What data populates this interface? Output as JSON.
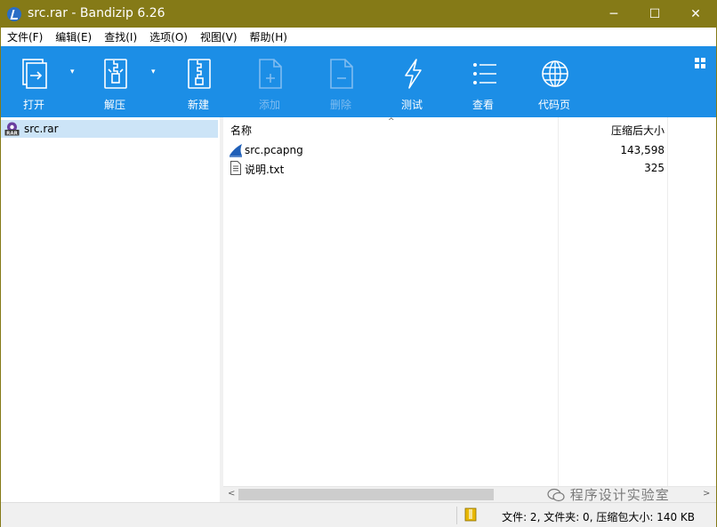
{
  "window": {
    "title": "src.rar - Bandizip 6.26",
    "title_color": "#857a17"
  },
  "titlebar_buttons": {
    "minimize": "─",
    "maximize": "☐",
    "close": "✕"
  },
  "menu": [
    "文件(F)",
    "编辑(E)",
    "查找(I)",
    "选项(O)",
    "视图(V)",
    "帮助(H)"
  ],
  "toolbar": {
    "background": "#1c8ee6",
    "buttons": [
      {
        "label": "打开",
        "icon": "open-file-icon",
        "enabled": true,
        "dropdown": true
      },
      {
        "label": "解压",
        "icon": "extract-zipper-icon",
        "enabled": true,
        "dropdown": true
      },
      {
        "label": "新建",
        "icon": "new-archive-icon",
        "enabled": true
      },
      {
        "label": "添加",
        "icon": "add-file-icon",
        "enabled": false
      },
      {
        "label": "删除",
        "icon": "delete-file-icon",
        "enabled": false
      },
      {
        "label": "测试",
        "icon": "lightning-icon",
        "enabled": true
      },
      {
        "label": "查看",
        "icon": "list-view-icon",
        "enabled": true
      },
      {
        "label": "代码页",
        "icon": "globe-icon",
        "enabled": true
      }
    ]
  },
  "sidebar": {
    "items": [
      {
        "label": "src.rar",
        "icon": "rar-archive-icon",
        "selected": true
      }
    ]
  },
  "filelist": {
    "columns": {
      "name": "名称",
      "packed_size": "压缩后大小"
    },
    "sort_indicator": "^",
    "files": [
      {
        "name": "src.pcapng",
        "packed_size": "143,598",
        "icon": "wireshark-fin-icon"
      },
      {
        "name": "说明.txt",
        "packed_size": "325",
        "icon": "text-file-icon"
      }
    ]
  },
  "scrollbar": {
    "left_arrow": "<",
    "right_arrow": ">"
  },
  "status": {
    "text": "文件: 2, 文件夹: 0, 压缩包大小: 140 KB"
  },
  "watermark": {
    "text": "程序设计实验室"
  }
}
